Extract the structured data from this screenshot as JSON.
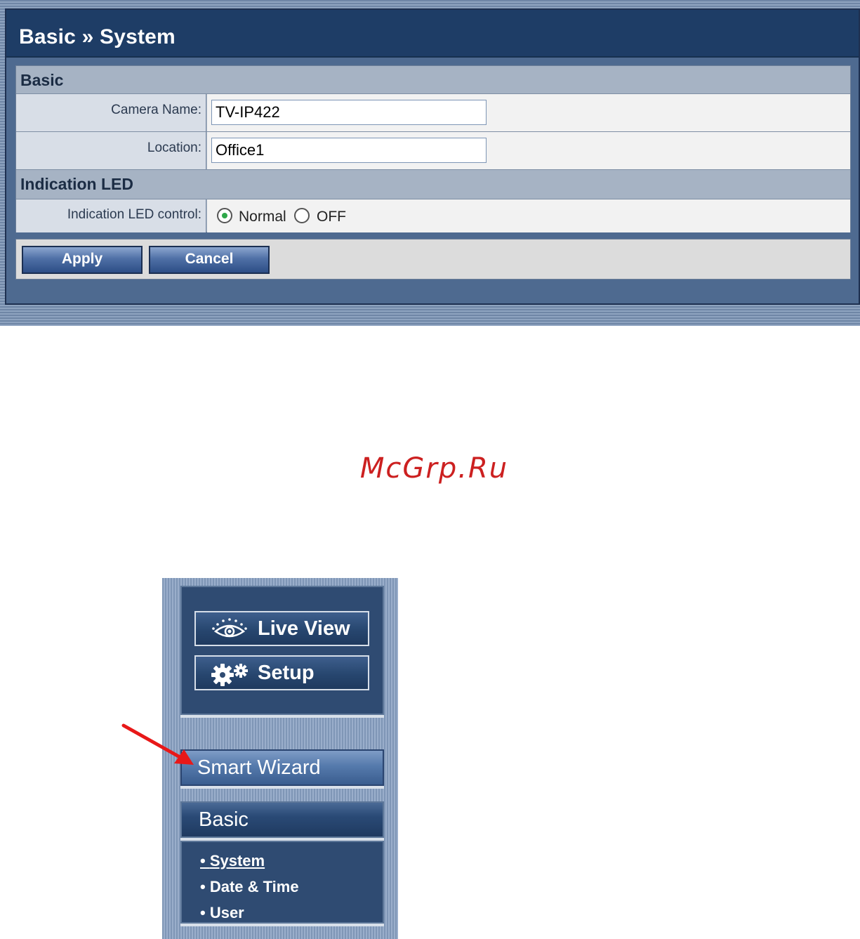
{
  "page": {
    "title": "Basic » System"
  },
  "form": {
    "section_basic": "Basic",
    "camera_name_label": "Camera Name:",
    "camera_name_value": "TV-IP422",
    "location_label": "Location:",
    "location_value": "Office1",
    "section_led": "Indication LED",
    "led_control_label": "Indication LED control:",
    "led_options": [
      "Normal",
      "OFF"
    ],
    "led_selected": "Normal"
  },
  "buttons": {
    "apply": "Apply",
    "cancel": "Cancel"
  },
  "watermark": "McGrp.Ru",
  "sidebar": {
    "live_view": "Live View",
    "setup": "Setup",
    "smart_wizard": "Smart Wizard",
    "basic_header": "Basic",
    "items": [
      {
        "label": "System",
        "active": true
      },
      {
        "label": "Date & Time",
        "active": false
      },
      {
        "label": "User",
        "active": false
      }
    ]
  },
  "colors": {
    "title_bar": "#1e3d66",
    "button": "#2d4e86",
    "watermark": "#cc2020",
    "arrow": "#e81818"
  }
}
